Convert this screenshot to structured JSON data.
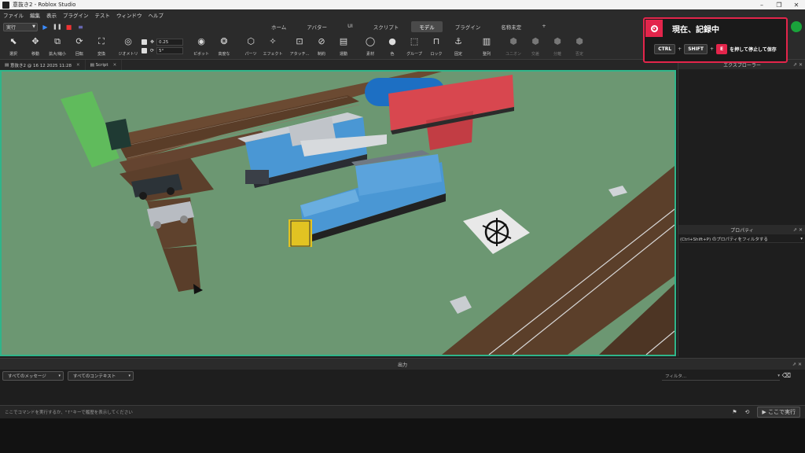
{
  "window": {
    "title": "意抜き2 - Roblox Studio",
    "controls": [
      "–",
      "❐",
      "✕"
    ]
  },
  "menu": [
    "ファイル",
    "編集",
    "表示",
    "プラグイン",
    "テスト",
    "ウィンドウ",
    "ヘルプ"
  ],
  "run_mode": "実行",
  "ribbon_tabs": [
    "ホーム",
    "アバター",
    "UI",
    "スクリプト",
    "モデル",
    "プラグイン",
    "名称未定",
    "+"
  ],
  "active_tab": "モデル",
  "tools": [
    {
      "label": "選択",
      "icon": "cursor-icon"
    },
    {
      "label": "移動",
      "icon": "move-icon"
    },
    {
      "label": "拡大/縮小",
      "icon": "scale-icon"
    },
    {
      "label": "回転",
      "icon": "rotate-icon"
    },
    {
      "label": "変換",
      "icon": "transform-icon"
    },
    {
      "label": "ジオメトリ",
      "icon": "geometry-icon"
    },
    {
      "label": "ピボット",
      "icon": "pivot-icon"
    },
    {
      "label": "高度な",
      "icon": "advanced-icon"
    },
    {
      "label": "パーツ",
      "icon": "part-icon"
    },
    {
      "label": "エフェクト",
      "icon": "effect-icon"
    },
    {
      "label": "アタッチ...",
      "icon": "attach-icon"
    },
    {
      "label": "制約",
      "icon": "constraint-icon"
    },
    {
      "label": "運動",
      "icon": "motion-icon"
    },
    {
      "label": "素材",
      "icon": "material-icon"
    },
    {
      "label": "色",
      "icon": "color-icon"
    },
    {
      "label": "グループ",
      "icon": "group-icon"
    },
    {
      "label": "ロック",
      "icon": "lock-icon"
    },
    {
      "label": "固定",
      "icon": "anchor-icon"
    },
    {
      "label": "整列",
      "icon": "align-icon"
    },
    {
      "label": "ユニオン",
      "icon": "union-icon"
    },
    {
      "label": "交差",
      "icon": "intersect-icon"
    },
    {
      "label": "分離",
      "icon": "separate-icon"
    },
    {
      "label": "否定",
      "icon": "negate-icon"
    }
  ],
  "snap": {
    "move_value": "0.25",
    "rotate_value": "5°"
  },
  "doc_tabs": [
    {
      "label": "意抜き2 @ 16 12 2025 11:28"
    },
    {
      "label": "Script"
    }
  ],
  "explorer": {
    "title": "エクスプローラー"
  },
  "properties": {
    "title": "プロパティ",
    "filter": "(Ctrl+Shift+P) のプロパティをフィルタする"
  },
  "output": {
    "title": "出力",
    "messages_dropdown": "すべてのメッセージ",
    "context_dropdown": "すべてのコンテキスト",
    "filter_placeholder": "フィルタ..."
  },
  "command": {
    "placeholder": "ここでコマンドを実行するか、\"↑\"キーで履歴を表示してください",
    "run_label": "▶ ここで実行"
  },
  "recording": {
    "title": "現在、記録中",
    "key1": "CTRL",
    "key2": "SHIFT",
    "key3": "E",
    "hint": "を押して停止して保存"
  },
  "colors": {
    "viewport_border": "#2fb58a",
    "record_accent": "#e3254b",
    "grass": "#6c9772",
    "train_blue": "#4a97d4",
    "tank_blue": "#1d6fc3",
    "container_red": "#d8474f"
  }
}
